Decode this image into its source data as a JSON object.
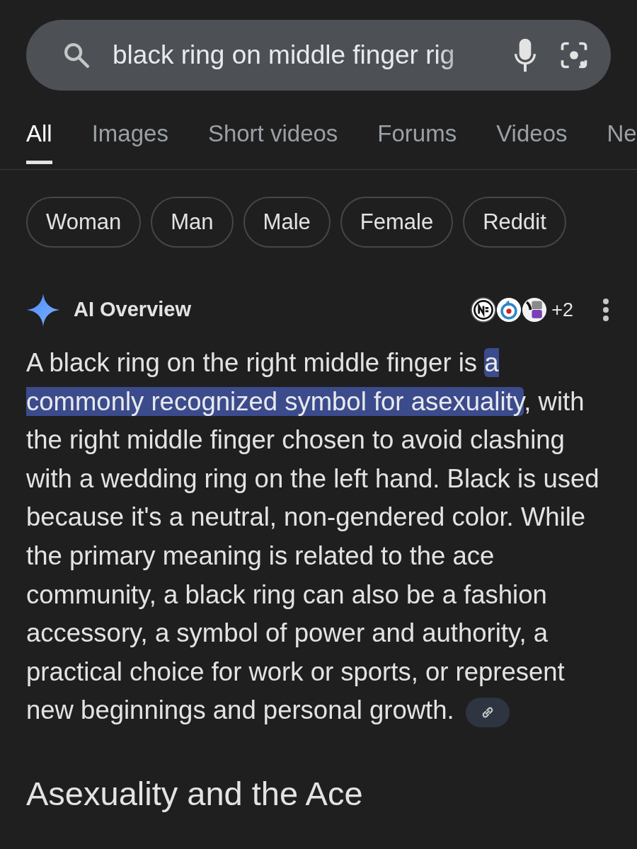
{
  "search": {
    "value": "black ring on middle finger rig"
  },
  "tabs": [
    {
      "label": "All",
      "selected": true
    },
    {
      "label": "Images",
      "selected": false
    },
    {
      "label": "Short videos",
      "selected": false
    },
    {
      "label": "Forums",
      "selected": false
    },
    {
      "label": "Videos",
      "selected": false
    },
    {
      "label": "Ne",
      "selected": false
    }
  ],
  "chips": [
    "Woman",
    "Man",
    "Male",
    "Female",
    "Reddit"
  ],
  "ai_overview": {
    "title": "AI Overview",
    "more_sources": "+2",
    "segments": [
      {
        "text": "A black ring on the right middle finger is ",
        "highlighted": false
      },
      {
        "text": "a commonly recognized symbol for asexuality",
        "highlighted": true
      },
      {
        "text": ", with the right middle finger chosen to avoid clashing with a wedding ring on the left hand. Black is used because it's a neutral, non-gendered color. While the primary meaning is related to the ace community, a black ring can also be a fashion accessory, a symbol of power and authority, a practical choice for work or sports, or represent new beginnings and personal growth.",
        "highlighted": false
      }
    ],
    "heading": "Asexuality and the Ace"
  }
}
